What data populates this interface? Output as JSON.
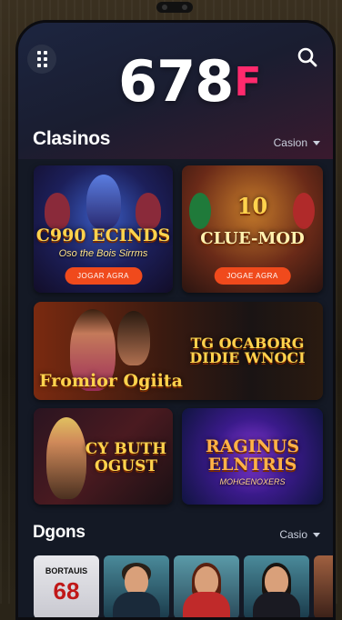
{
  "app": {
    "logo_main": "678",
    "logo_suffix": "F",
    "accent": "#ff2a6d"
  },
  "icons": {
    "menu": "grid-menu-icon",
    "search": "search-icon",
    "dropdown": "caret-down-icon"
  },
  "sections": {
    "casinos": {
      "title": "Clasinos",
      "link": "Casion"
    },
    "games": {
      "title": "Dgons",
      "link": "Casio"
    }
  },
  "cards": [
    {
      "title": "C990 ECINDS",
      "subtitle": "Oso the Bois Sirrms",
      "button": "JOGAR AGRA"
    },
    {
      "title": "CLUE-MOD",
      "badge": "10",
      "button": "JOGAE AGRA"
    },
    {
      "title": "TG OCABORG DIDIE WNOCI",
      "subtitle": "Fromior Ogiita"
    },
    {
      "title": "CY BUTH OGUST"
    },
    {
      "title": "RAGINUS ELNTRIS",
      "subtitle": "MOHGENOXERS"
    }
  ],
  "bottom_thumbs": [
    {
      "line1": "BORTAUIS",
      "line2": "68"
    }
  ]
}
